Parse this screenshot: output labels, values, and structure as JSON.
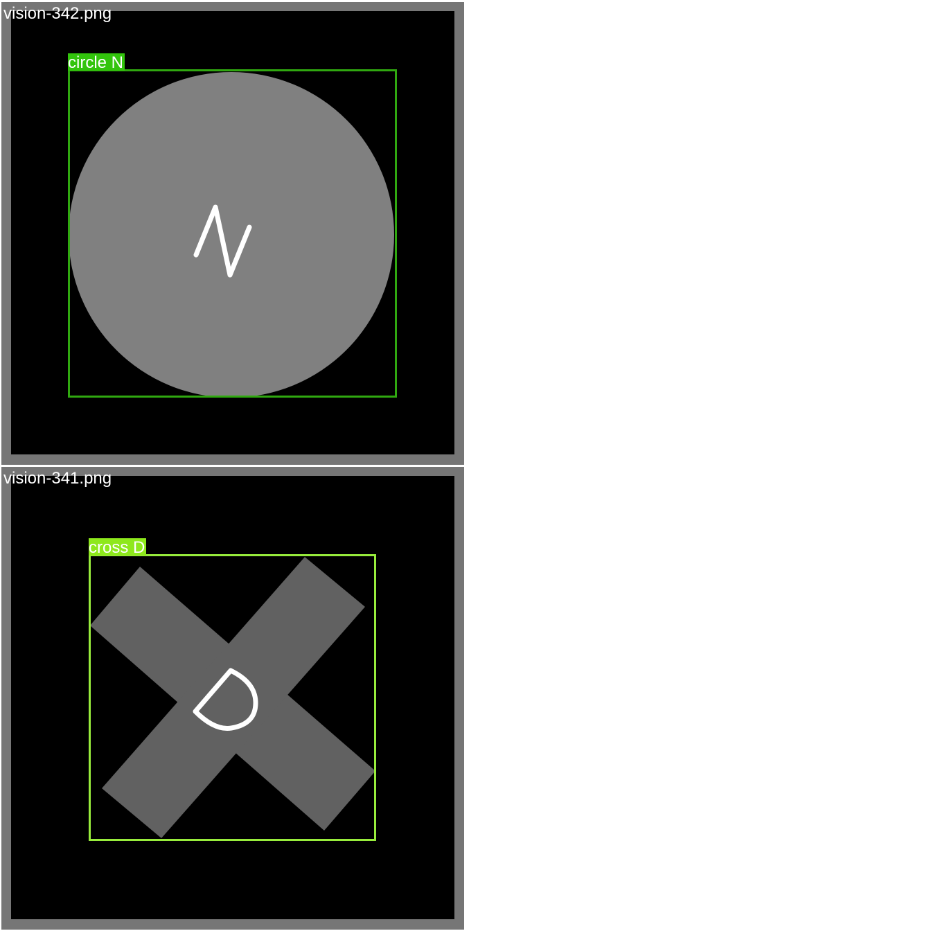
{
  "colors": {
    "panel_frame": "#767676",
    "image_background": "#000000",
    "circle_fill": "#808080",
    "cross_fill": "#616161",
    "glyph_stroke": "#ffffff",
    "circle_box": "#30a810",
    "circle_label_bg": "#32c40c",
    "cross_box": "#98ec3c",
    "cross_label_bg": "#8ee81c"
  },
  "panels": [
    {
      "filename": "vision-342.png",
      "shape": "circle",
      "glyph": "N",
      "detection": {
        "label": "circle N"
      }
    },
    {
      "filename": "vision-341.png",
      "shape": "cross",
      "glyph": "D",
      "detection": {
        "label": "cross D"
      }
    }
  ]
}
